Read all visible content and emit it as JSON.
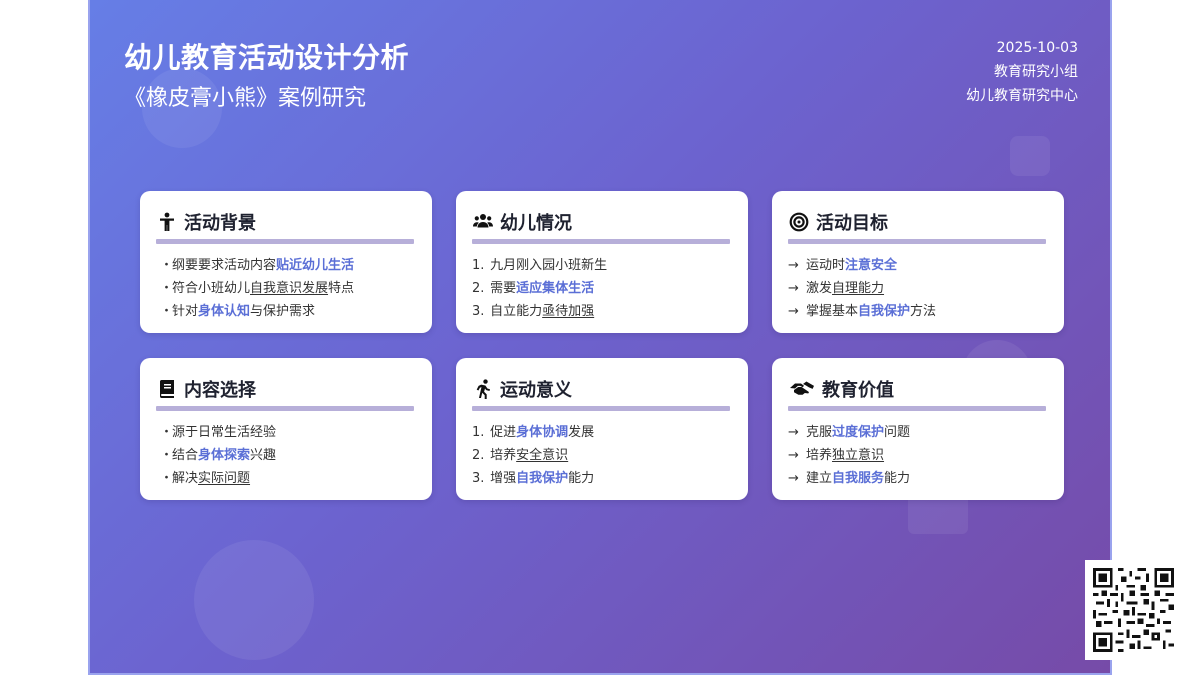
{
  "header": {
    "title": "幼儿教育活动设计分析",
    "subtitle": "《橡皮膏小熊》案例研究",
    "date": "2025-10-03",
    "team": "教育研究小组",
    "org": "幼儿教育研究中心"
  },
  "colors": {
    "accent": "#5b6fd6",
    "rule": "#b7afd9",
    "bg_start": "#667ee6",
    "bg_end": "#764ba8"
  },
  "cards": [
    {
      "icon": "child-icon",
      "title": "活动背景",
      "marker": "・",
      "items": [
        {
          "pre": "纲要要求活动内容",
          "em": "贴近幼儿生活",
          "em_style": "hl",
          "post": ""
        },
        {
          "pre": "符合小班幼儿",
          "em": "自我意识发展",
          "em_style": "ul",
          "post": "特点"
        },
        {
          "pre": "针对",
          "em": "身体认知",
          "em_style": "hl",
          "post": "与保护需求"
        }
      ]
    },
    {
      "icon": "users-icon",
      "title": "幼儿情况",
      "marker": "num",
      "items": [
        {
          "n": "1.",
          "pre": "九月刚入园小班新生",
          "em": "",
          "em_style": "",
          "post": ""
        },
        {
          "n": "2.",
          "pre": "需要",
          "em": "适应集体生活",
          "em_style": "hl",
          "post": ""
        },
        {
          "n": "3.",
          "pre": "自立能力",
          "em": "亟待加强",
          "em_style": "ul",
          "post": ""
        }
      ]
    },
    {
      "icon": "target-icon",
      "title": "活动目标",
      "marker": "→",
      "items": [
        {
          "pre": "运动时",
          "em": "注意安全",
          "em_style": "hl",
          "post": ""
        },
        {
          "pre": "激发",
          "em": "自理能力",
          "em_style": "ul",
          "post": ""
        },
        {
          "pre": "掌握基本",
          "em": "自我保护",
          "em_style": "hl",
          "post": "方法"
        }
      ]
    },
    {
      "icon": "book-icon",
      "title": "内容选择",
      "marker": "・",
      "items": [
        {
          "pre": "源于日常生活经验",
          "em": "",
          "em_style": "",
          "post": ""
        },
        {
          "pre": "结合",
          "em": "身体探索",
          "em_style": "hl",
          "post": "兴趣"
        },
        {
          "pre": "解决",
          "em": "实际问题",
          "em_style": "ul",
          "post": ""
        }
      ]
    },
    {
      "icon": "running-icon",
      "title": "运动意义",
      "marker": "num",
      "items": [
        {
          "n": "1.",
          "pre": "促进",
          "em": "身体协调",
          "em_style": "hl",
          "post": "发展"
        },
        {
          "n": "2.",
          "pre": "培养",
          "em": "安全意识",
          "em_style": "ul",
          "post": ""
        },
        {
          "n": "3.",
          "pre": "增强",
          "em": "自我保护",
          "em_style": "hl",
          "post": "能力"
        }
      ]
    },
    {
      "icon": "hands-icon",
      "title": "教育价值",
      "marker": "→",
      "items": [
        {
          "pre": "克服",
          "em": "过度保护",
          "em_style": "hl",
          "post": "问题"
        },
        {
          "pre": "培养",
          "em": "独立意识",
          "em_style": "ul",
          "post": ""
        },
        {
          "pre": "建立",
          "em": "自我服务",
          "em_style": "hl",
          "post": "能力"
        }
      ]
    }
  ],
  "qr": {
    "icon": "qr-code-icon"
  }
}
